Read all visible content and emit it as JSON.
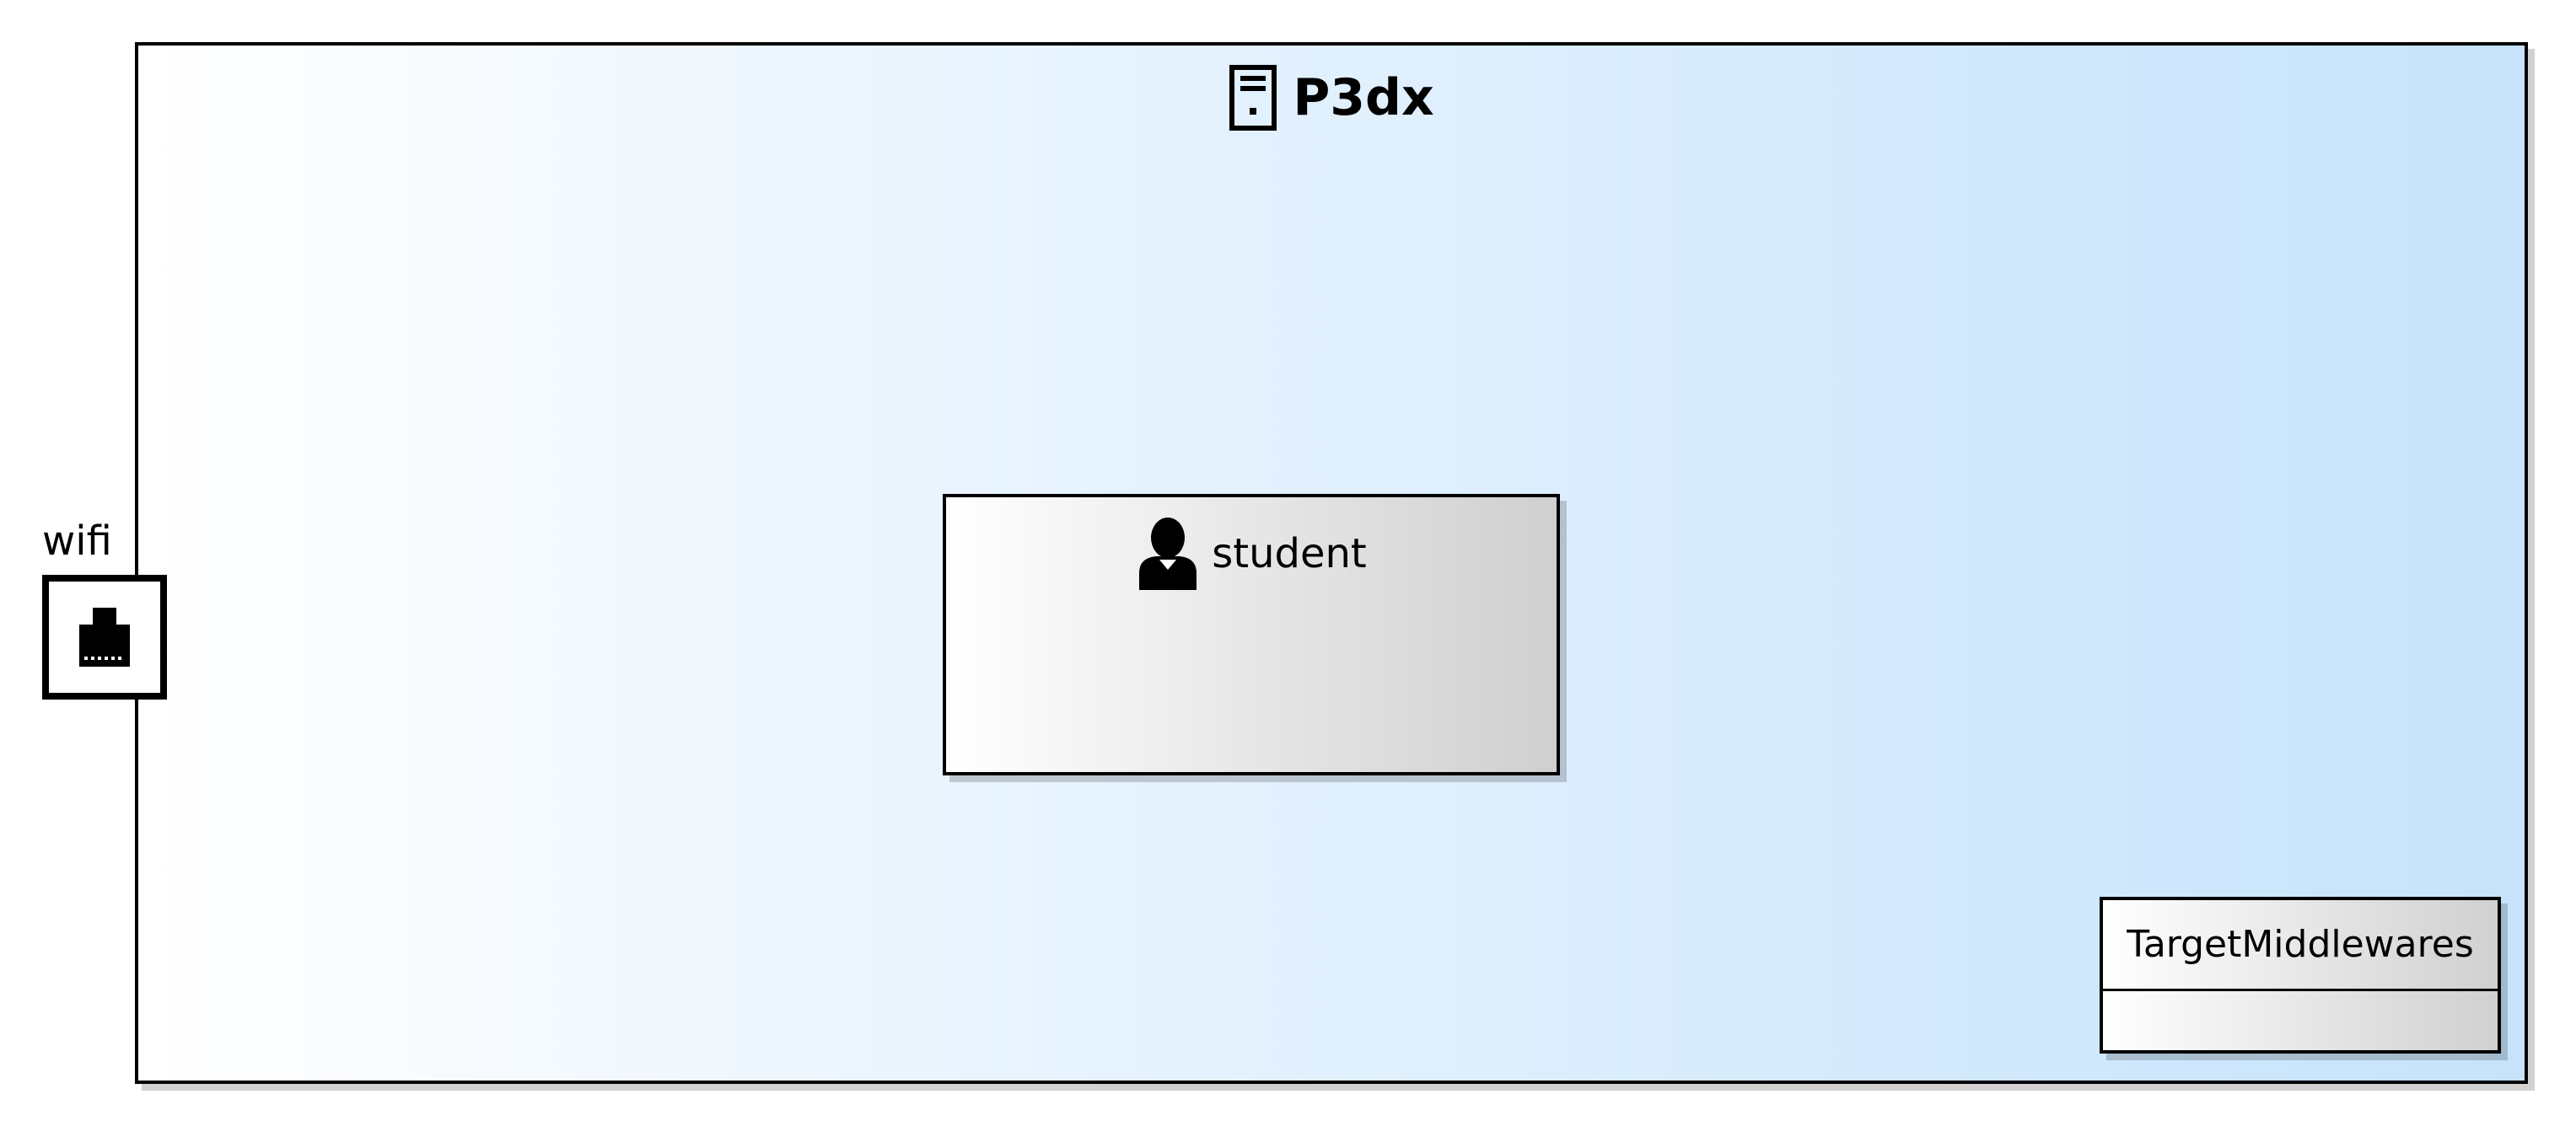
{
  "node": {
    "name": "P3dx",
    "icon": "device-icon",
    "fill_gradient": [
      "#ffffff",
      "#c6e3fb"
    ]
  },
  "part": {
    "name": "student",
    "icon": "person-icon",
    "fill_gradient": [
      "#ffffff",
      "#cfcfcf"
    ]
  },
  "port": {
    "name": "wifi",
    "icon": "network-port-icon"
  },
  "class_box": {
    "name": "TargetMiddlewares"
  }
}
